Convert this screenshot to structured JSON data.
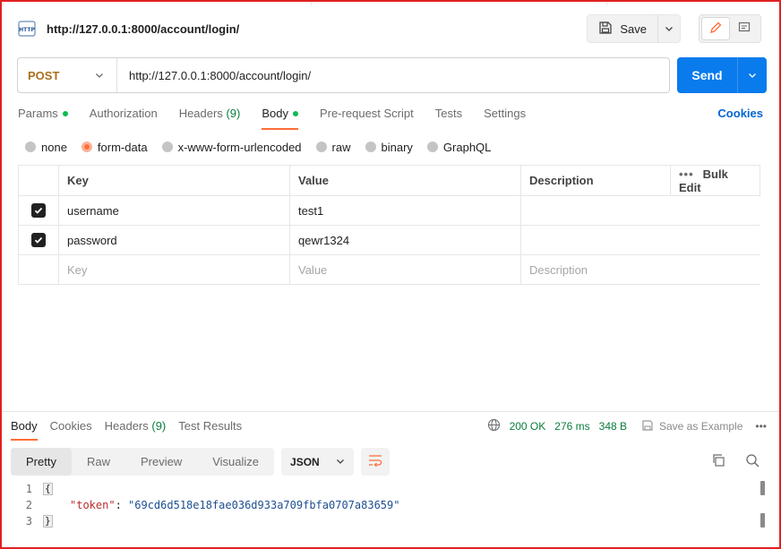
{
  "header": {
    "title": "http://127.0.0.1:8000/account/login/",
    "save_label": "Save"
  },
  "request": {
    "method": "POST",
    "url": "http://127.0.0.1:8000/account/login/",
    "send_label": "Send"
  },
  "tabs": {
    "params": "Params",
    "authorization": "Authorization",
    "headers": "Headers",
    "headers_count": "(9)",
    "body": "Body",
    "prerequest": "Pre-request Script",
    "tests": "Tests",
    "settings": "Settings",
    "cookies": "Cookies"
  },
  "body_types": {
    "none": "none",
    "form_data": "form-data",
    "urlencoded": "x-www-form-urlencoded",
    "raw": "raw",
    "binary": "binary",
    "graphql": "GraphQL",
    "selected": "form-data"
  },
  "table": {
    "headers": {
      "key": "Key",
      "value": "Value",
      "description": "Description",
      "bulk_edit": "Bulk Edit"
    },
    "rows": [
      {
        "checked": true,
        "key": "username",
        "value": "test1",
        "description": ""
      },
      {
        "checked": true,
        "key": "password",
        "value": "qewr1324",
        "description": ""
      }
    ],
    "placeholders": {
      "key": "Key",
      "value": "Value",
      "description": "Description"
    }
  },
  "response": {
    "tabs": {
      "body": "Body",
      "cookies": "Cookies",
      "headers": "Headers",
      "headers_count": "(9)",
      "test_results": "Test Results"
    },
    "status": "200 OK",
    "time": "276 ms",
    "size": "348 B",
    "save_example": "Save as Example",
    "view_modes": {
      "pretty": "Pretty",
      "raw": "Raw",
      "preview": "Preview",
      "visualize": "Visualize"
    },
    "format": "JSON",
    "code": {
      "line_numbers": [
        "1",
        "2",
        "3"
      ],
      "open_brace": "{",
      "close_brace": "}",
      "key": "\"token\"",
      "colon": ": ",
      "value": "\"69cd6d518e18fae036d933a709fbfa0707a83659\""
    }
  },
  "colors": {
    "accent": "#ff6c37",
    "send": "#097bed",
    "method": "#a8711b",
    "status_green": "#0a7d3c",
    "link": "#0265d2"
  },
  "icons": [
    "http-icon",
    "save-icon",
    "chevron-down-icon",
    "pencil-icon",
    "comment-icon",
    "globe-icon",
    "save-example-icon",
    "more-icon",
    "wrap-icon",
    "copy-icon",
    "search-icon",
    "check-icon"
  ]
}
